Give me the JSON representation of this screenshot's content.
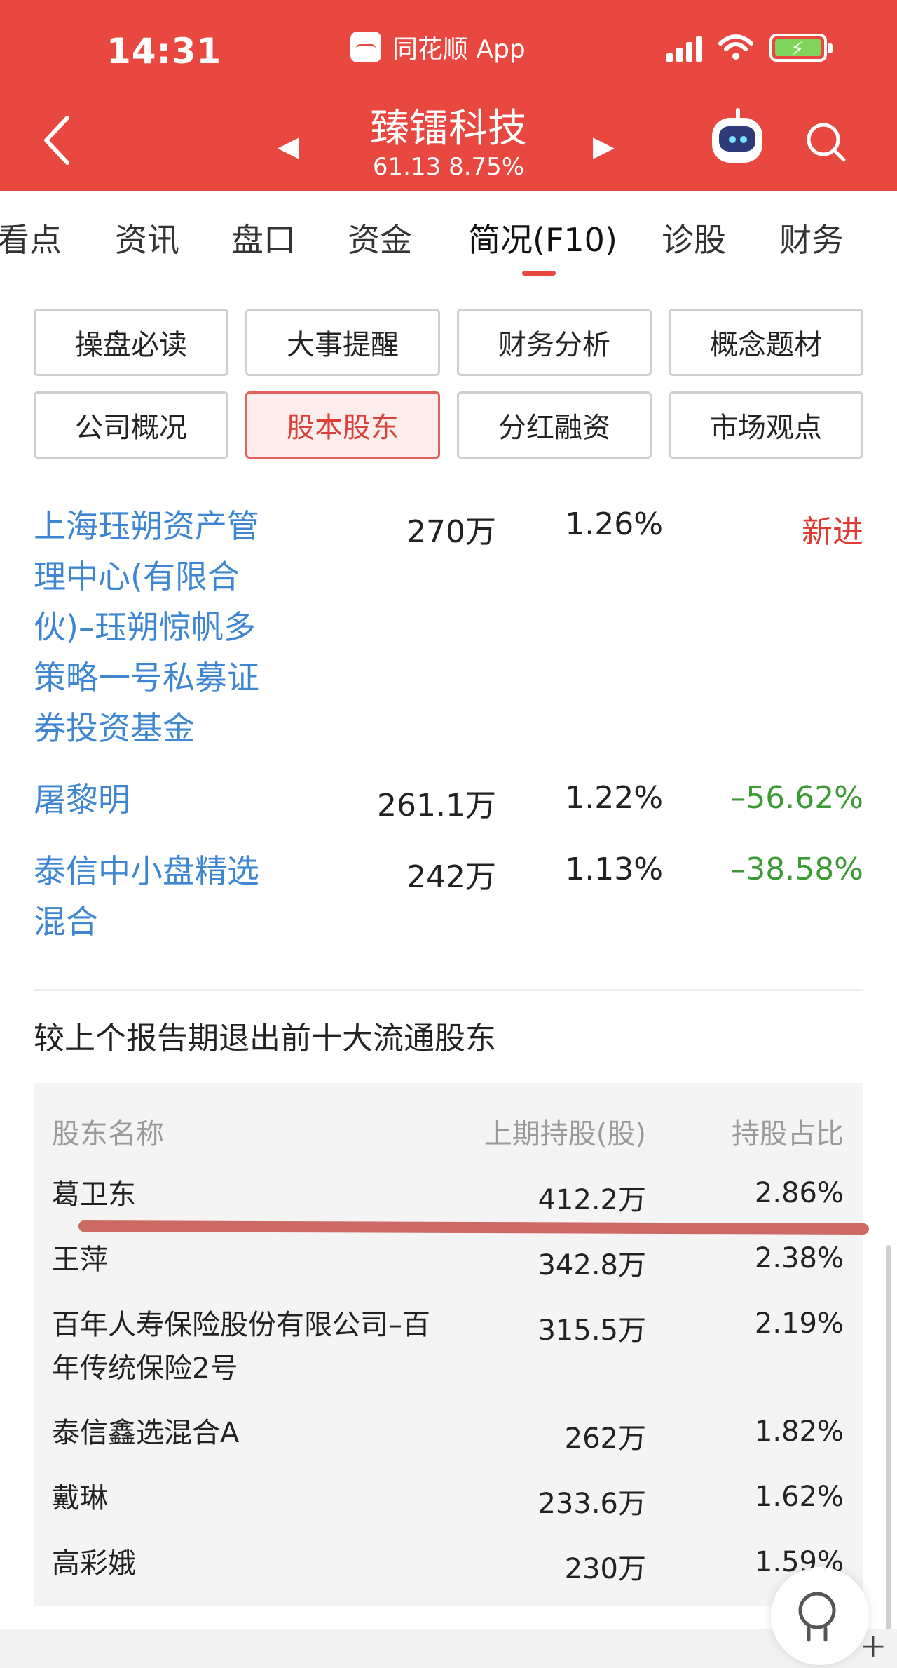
{
  "status_bar": {
    "time": "14:31",
    "app": "同花顺 App"
  },
  "nav": {
    "title": "臻镭科技",
    "subtitle": "61.13 8.75%"
  },
  "tabs": [
    "看点",
    "资讯",
    "盘口",
    "资金",
    "简况(F10)",
    "诊股",
    "财务"
  ],
  "active_tab": "简况(F10)",
  "buttons": [
    "操盘必读",
    "大事提醒",
    "财务分析",
    "概念题材",
    "公司概况",
    "股本股东",
    "分红融资",
    "市场观点"
  ],
  "active_button": "股本股东",
  "holders": [
    {
      "name": "上海珏朔资产管理中心(有限合伙)–珏朔惊帆多策略一号私募证券投资基金",
      "shares": "270万",
      "pct": "1.26%",
      "change": "新进",
      "change_color": "#dd3b33"
    },
    {
      "name": "屠黎明",
      "shares": "261.1万",
      "pct": "1.22%",
      "change": "–56.62%",
      "change_color": "#3d9b35"
    },
    {
      "name": "泰信中小盘精选混合",
      "shares": "242万",
      "pct": "1.13%",
      "change": "–38.58%",
      "change_color": "#3d9b35"
    }
  ],
  "exit_section": {
    "title": "较上个报告期退出前十大流通股东",
    "headers": [
      "股东名称",
      "上期持股(股)",
      "持股占比"
    ],
    "rows": [
      {
        "name": "葛卫东",
        "prev": "412.2万",
        "ratio": "2.86%"
      },
      {
        "name": "王萍",
        "prev": "342.8万",
        "ratio": "2.38%"
      },
      {
        "name": "百年人寿保险股份有限公司–百年传统保险2号",
        "prev": "315.5万",
        "ratio": "2.19%"
      },
      {
        "name": "泰信鑫选混合A",
        "prev": "262万",
        "ratio": "1.82%"
      },
      {
        "name": "戴琳",
        "prev": "233.6万",
        "ratio": "1.62%"
      },
      {
        "name": "高彩娥",
        "prev": "230万",
        "ratio": "1.59%"
      }
    ]
  },
  "colors": {
    "header_bg": "#e8483f",
    "link": "#3e86d2",
    "up": "#dd3b33",
    "down": "#3d9b35",
    "highlight_mark": "#c85a52"
  }
}
